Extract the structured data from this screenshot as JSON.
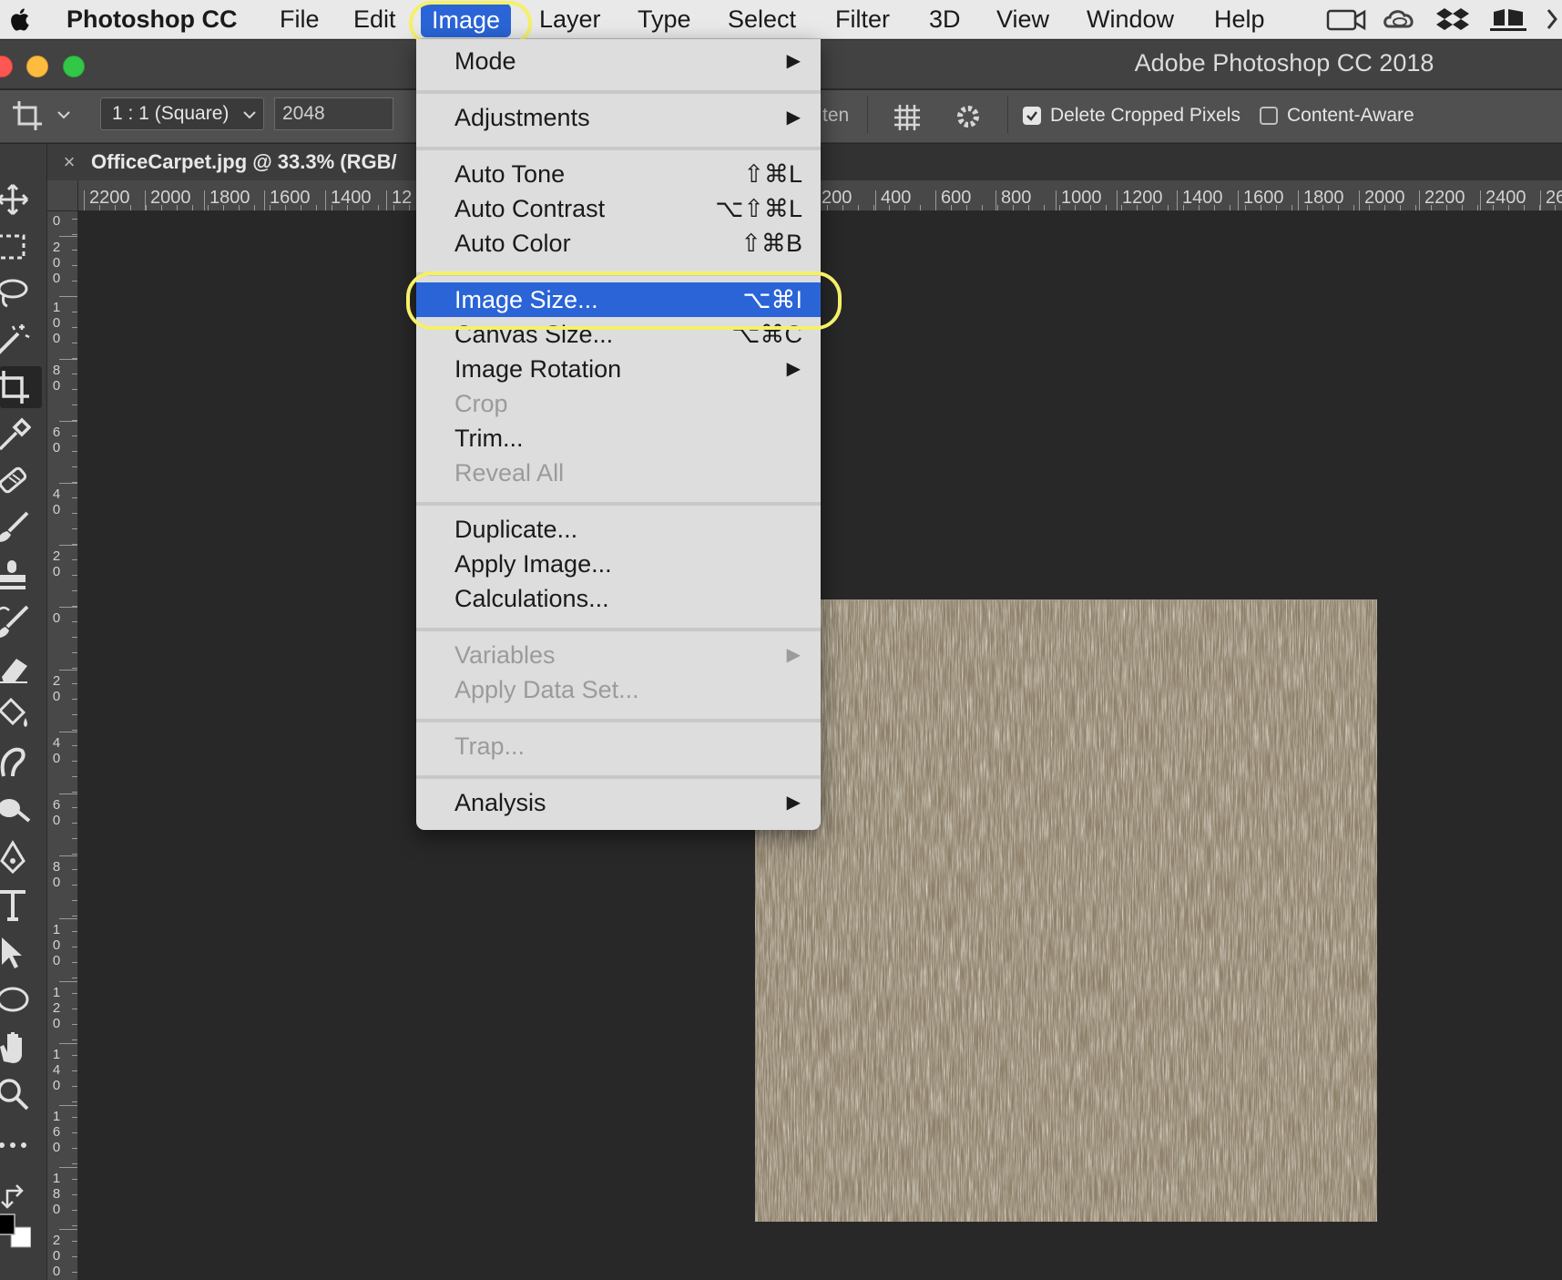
{
  "menubar": {
    "app_name": "Photoshop CC",
    "items": [
      {
        "label": "File"
      },
      {
        "label": "Edit"
      },
      {
        "label": "Image"
      },
      {
        "label": "Layer"
      },
      {
        "label": "Type"
      },
      {
        "label": "Select"
      },
      {
        "label": "Filter"
      },
      {
        "label": "3D"
      },
      {
        "label": "View"
      },
      {
        "label": "Window"
      },
      {
        "label": "Help"
      }
    ],
    "active_item": "Image",
    "tray_icons": [
      "video-camera-icon",
      "creative-cloud-icon",
      "dropbox-icon",
      "menu-extra-icon"
    ]
  },
  "window": {
    "title": "Adobe Photoshop CC 2018",
    "traffic_lights": [
      "close-button",
      "minimize-button",
      "zoom-button"
    ]
  },
  "options_bar": {
    "tool_icon": "crop-icon",
    "ratio_select": "1 : 1 (Square)",
    "width_value": "2048",
    "straighten_label": "ten",
    "grid_icon": "overlay-grid-icon",
    "settings_icon": "gear-icon",
    "delete_cropped_label": "Delete Cropped Pixels",
    "delete_cropped_checked": true,
    "content_aware_label": "Content-Aware",
    "content_aware_checked": false
  },
  "document_tab": {
    "close_label": "×",
    "title": "OfficeCarpet.jpg @ 33.3% (RGB/"
  },
  "ruler_h": [
    "2200",
    "2000",
    "1800",
    "1600",
    "1400",
    "12",
    "200",
    "400",
    "600",
    "800",
    "1000",
    "1200",
    "1400",
    "1600",
    "1800",
    "2000",
    "2200",
    "2400",
    "26"
  ],
  "ruler_v": [
    "0",
    "200",
    "100",
    "80",
    "60",
    "40",
    "20",
    "0",
    "20",
    "40",
    "60",
    "80",
    "100",
    "120",
    "140",
    "160",
    "180",
    "200"
  ],
  "tools": [
    "move-icon",
    "marquee-icon",
    "lasso-icon",
    "magic-wand-icon",
    "crop-icon",
    "eyedropper-icon",
    "healing-brush-icon",
    "brush-icon",
    "clone-stamp-icon",
    "history-brush-icon",
    "eraser-icon",
    "paint-bucket-icon",
    "smudge-icon",
    "dodge-icon",
    "pen-icon",
    "type-icon",
    "path-selection-icon",
    "ellipse-icon",
    "hand-icon",
    "zoom-icon",
    "more-tools-icon",
    "swap-colors-icon",
    "color-swatches-icon"
  ],
  "image_menu": {
    "items": [
      {
        "label": "Mode",
        "submenu": true
      },
      {
        "separator": true
      },
      {
        "label": "Adjustments",
        "submenu": true
      },
      {
        "separator": true
      },
      {
        "label": "Auto Tone",
        "shortcut": "⇧⌘L"
      },
      {
        "label": "Auto Contrast",
        "shortcut": "⌥⇧⌘L"
      },
      {
        "label": "Auto Color",
        "shortcut": "⇧⌘B"
      },
      {
        "separator": true
      },
      {
        "label": "Image Size...",
        "shortcut": "⌥⌘I",
        "selected": true
      },
      {
        "label": "Canvas Size...",
        "shortcut": "⌥⌘C"
      },
      {
        "label": "Image Rotation",
        "submenu": true
      },
      {
        "label": "Crop",
        "disabled": true
      },
      {
        "label": "Trim..."
      },
      {
        "label": "Reveal All",
        "disabled": true
      },
      {
        "separator": true
      },
      {
        "label": "Duplicate..."
      },
      {
        "label": "Apply Image..."
      },
      {
        "label": "Calculations..."
      },
      {
        "separator": true
      },
      {
        "label": "Variables",
        "submenu": true,
        "disabled": true
      },
      {
        "label": "Apply Data Set...",
        "disabled": true
      },
      {
        "separator": true
      },
      {
        "label": "Trap...",
        "disabled": true
      },
      {
        "separator": true
      },
      {
        "label": "Analysis",
        "submenu": true
      }
    ]
  },
  "colors": {
    "highlight": "#2a64d6",
    "annotation_ring": "#f5f068",
    "canvas": "#282828",
    "carpet_base": "#8d7f68"
  }
}
